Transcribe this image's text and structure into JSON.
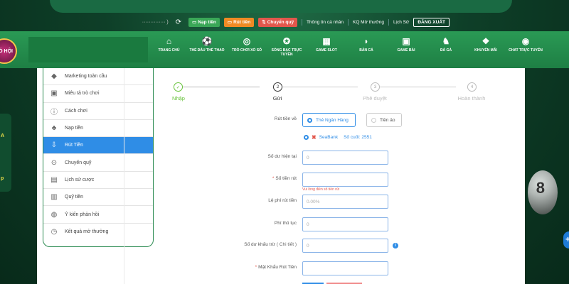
{
  "topbar": {
    "user_masked": "·············· )",
    "deposit": "Nạp tiền",
    "withdraw": "Rút tiền",
    "transfer": "Chuyển quỹ",
    "links": [
      "Thông tin cá nhân",
      "KQ Mở thưởng",
      "Lịch Sử"
    ],
    "logout": "ĐĂNG XUẤT"
  },
  "logo_text": "RÓ HỘI",
  "nav": {
    "items": [
      {
        "icon": "home-icon",
        "label": "TRANG CHỦ"
      },
      {
        "icon": "soccer-ball-icon",
        "label": "THỂ ĐẤU THỂ THAO"
      },
      {
        "icon": "lottery-icon",
        "label": "TRÒ CHƠI XỔ SỐ"
      },
      {
        "icon": "casino-chip-icon",
        "label": "SÒNG BẠC TRỰC TUYẾN"
      },
      {
        "icon": "slot-machine-icon",
        "label": "GAME SLOT"
      },
      {
        "icon": "fish-icon",
        "label": "BẮN CÁ"
      },
      {
        "icon": "gamepad-icon",
        "label": "GAME BÀI"
      },
      {
        "icon": "rooster-icon",
        "label": "ĐÁ GÀ"
      },
      {
        "icon": "gift-icon",
        "label": "KHUYẾN MÃI"
      },
      {
        "icon": "headset-icon",
        "label": "CHAT TRỰC TUYẾN"
      }
    ]
  },
  "side_deco": {
    "top": "A",
    "bottom": "p"
  },
  "ball_number": "8",
  "sidebar": {
    "items": [
      {
        "icon": "diamond-icon",
        "label": "Marketing toàn cầu"
      },
      {
        "icon": "gamepad-icon",
        "label": "Miêu tả trò chơi"
      },
      {
        "icon": "info-icon",
        "label": "Cách chơi"
      },
      {
        "icon": "piggy-bank-icon",
        "label": "Nạp tiền"
      },
      {
        "icon": "withdraw-icon",
        "label": "Rút Tiền",
        "active": true
      },
      {
        "icon": "transfer-icon",
        "label": "Chuyển quỹ"
      },
      {
        "icon": "history-icon",
        "label": "Lịch sử cược"
      },
      {
        "icon": "wallet-icon",
        "label": "Quỹ tiền"
      },
      {
        "icon": "comment-icon",
        "label": "Ý kiến phản hồi"
      },
      {
        "icon": "clock-icon",
        "label": "Kết quả mở thưởng"
      }
    ]
  },
  "steps": [
    {
      "num": "✓",
      "label": "Nhập",
      "state": "done"
    },
    {
      "num": "2",
      "label": "Gửi",
      "state": "current"
    },
    {
      "num": "3",
      "label": "Phê duyệt",
      "state": "pending"
    },
    {
      "num": "4",
      "label": "Hoàn thành",
      "state": "pending"
    }
  ],
  "form": {
    "withdraw_to_label": "Rút tiền về",
    "option_bank": "Thẻ Ngân Hàng",
    "option_crypto": "Tiền ảo",
    "bank_name": "SeaBank",
    "bank_last_digits": "Số cuối: 2551",
    "current_balance_label": "Số dư hiện tại",
    "current_balance_value": "0",
    "amount_label": "Số tiền rút",
    "amount_error": "Vui lòng điền số tiền rút",
    "fee_label": "Lệ phí rút tiền",
    "fee_value": "0.00%",
    "handling_label": "Phí thủ tục",
    "handling_value": "0",
    "deduct_label": "Số dư khấu trừ",
    "deduct_link": "( Chi tiết )",
    "deduct_value": "0",
    "password_label": "Mật Khẩu Rút Tiền"
  },
  "colors": {
    "brand_green": "#1e7f44",
    "accent_blue": "#2f8de6",
    "error_red": "#e2574c"
  }
}
